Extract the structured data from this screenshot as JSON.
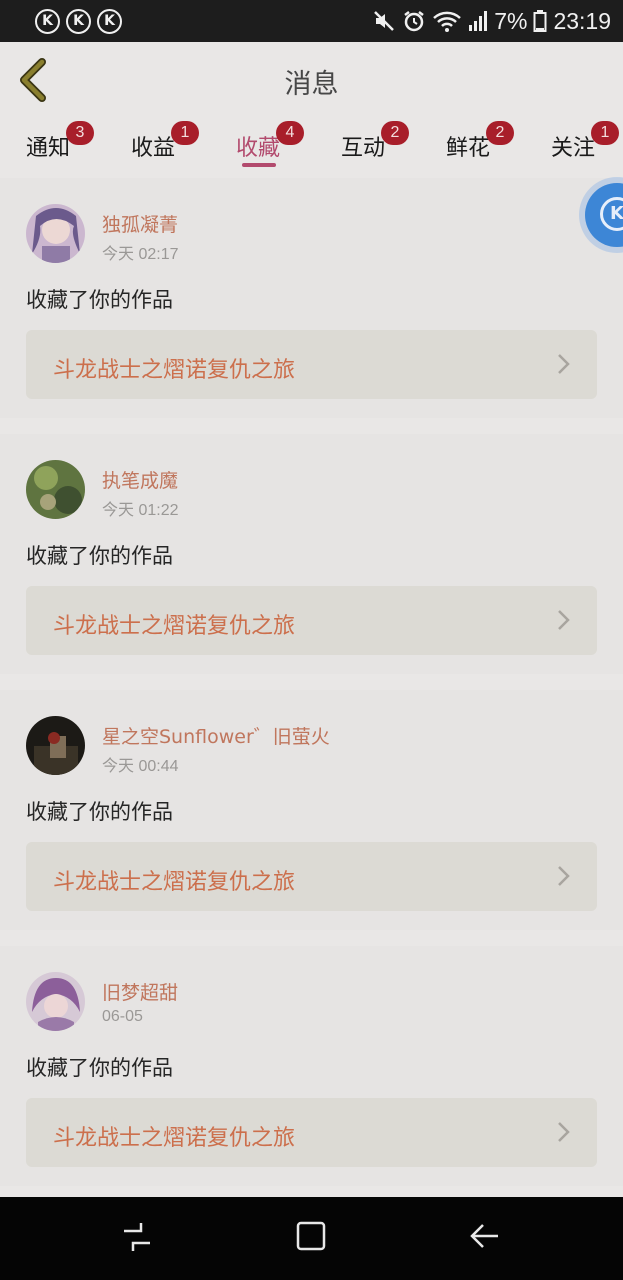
{
  "status_bar": {
    "k_icons": [
      "K",
      "K",
      "K"
    ],
    "battery_text": "7%",
    "time": "23:19"
  },
  "header": {
    "title": "消息"
  },
  "tabs": [
    {
      "label": "通知",
      "badge": "3",
      "active": false
    },
    {
      "label": "收益",
      "badge": "1",
      "active": false
    },
    {
      "label": "收藏",
      "badge": "4",
      "active": true
    },
    {
      "label": "互动",
      "badge": "2",
      "active": false
    },
    {
      "label": "鲜花",
      "badge": "2",
      "active": false
    },
    {
      "label": "关注",
      "badge": "1",
      "active": false
    }
  ],
  "items": [
    {
      "username": "独孤凝菁",
      "time": "今天 02:17",
      "action": "收藏了你的作品",
      "work_title": "斗龙战士之熠诺复仇之旅"
    },
    {
      "username": "执笔成魔",
      "time": "今天 01:22",
      "action": "收藏了你的作品",
      "work_title": "斗龙战士之熠诺复仇之旅"
    },
    {
      "username": "星之空Sunflower゛旧萤火",
      "time": "今天 00:44",
      "action": "收藏了你的作品",
      "work_title": "斗龙战士之熠诺复仇之旅"
    },
    {
      "username": "旧梦超甜",
      "time": "06-05",
      "action": "收藏了你的作品",
      "work_title": "斗龙战士之熠诺复仇之旅"
    }
  ],
  "floating_badge": {
    "letter": "K"
  },
  "colors": {
    "accent": "#b24a6d",
    "badge": "#a81e2a",
    "username": "#c0765d",
    "work_title": "#cc6f4c",
    "floating": "#3d86d6"
  }
}
